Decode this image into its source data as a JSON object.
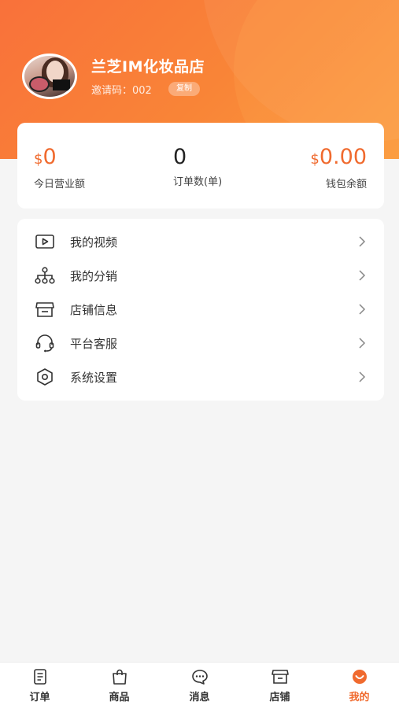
{
  "header": {
    "shop_name": "兰芝IM化妆品店",
    "invite_code": "邀请码：002",
    "copy_label": "复制"
  },
  "stats": [
    {
      "currency": "$",
      "value": "0",
      "label": "今日营业额"
    },
    {
      "currency": "",
      "value": "0",
      "label": "订单数(单)"
    },
    {
      "currency": "$",
      "value": "0.00",
      "label": "钱包余额"
    }
  ],
  "menu": [
    {
      "label": "我的视频",
      "icon": "video-icon"
    },
    {
      "label": "我的分销",
      "icon": "distribution-icon"
    },
    {
      "label": "店铺信息",
      "icon": "store-icon"
    },
    {
      "label": "平台客服",
      "icon": "headset-icon"
    },
    {
      "label": "系统设置",
      "icon": "settings-icon"
    }
  ],
  "tabs": [
    {
      "label": "订单",
      "icon": "order-icon"
    },
    {
      "label": "商品",
      "icon": "bag-icon"
    },
    {
      "label": "消息",
      "icon": "message-icon"
    },
    {
      "label": "店铺",
      "icon": "store-icon"
    },
    {
      "label": "我的",
      "icon": "profile-icon",
      "active": true
    }
  ],
  "colors": {
    "accent": "#f06a2e",
    "header_gradient_start": "#f9713a",
    "header_gradient_end": "#fb9a3e"
  }
}
